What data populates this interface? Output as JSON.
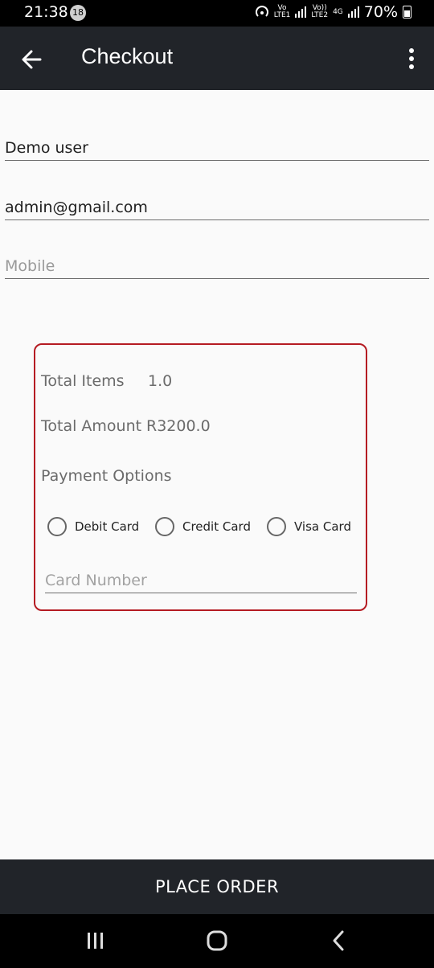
{
  "status": {
    "time": "21:38",
    "notif_count": "18",
    "sim1": "Vo\nLTE1",
    "sim2": "Vo)) LTE2",
    "network": "4G",
    "battery": "70%"
  },
  "appbar": {
    "title": "Checkout",
    "back_icon": "arrow-left-icon",
    "menu_icon": "more-vert-icon"
  },
  "form": {
    "name_value": "Demo user",
    "email_value": "admin@gmail.com",
    "mobile_placeholder": "Mobile"
  },
  "summary": {
    "total_items_label": "Total Items",
    "total_items_value": "1.0",
    "total_amount_label": "Total Amount",
    "total_amount_value": "R3200.0",
    "payment_options_label": "Payment Options",
    "options": [
      "Debit Card",
      "Credit Card",
      "Visa Card"
    ],
    "card_number_placeholder": "Card Number",
    "accent_color": "#b51b22"
  },
  "footer": {
    "place_order_label": "PLACE ORDER"
  },
  "nav": {
    "recent_icon": "recent-apps-icon",
    "home_icon": "home-icon",
    "back_icon": "back-chevron-icon"
  }
}
